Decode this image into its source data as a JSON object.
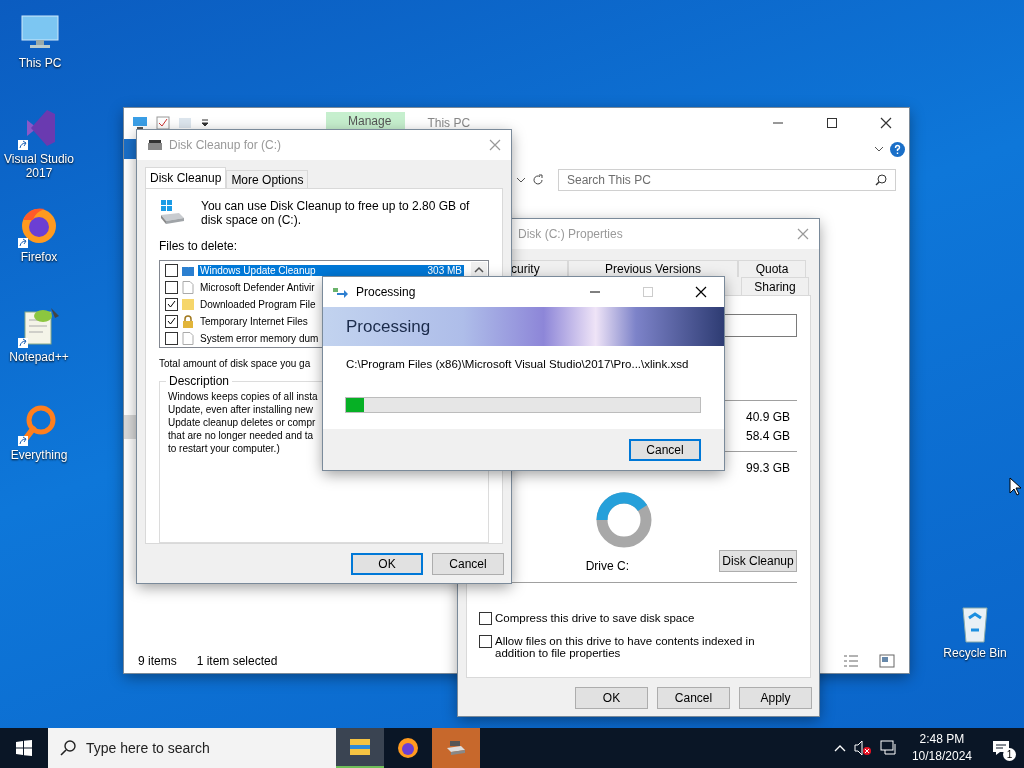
{
  "desktop_icons": [
    {
      "label": "This PC",
      "kind": "pc"
    },
    {
      "label": "Visual Studio 2017",
      "kind": "vs"
    },
    {
      "label": "Firefox",
      "kind": "firefox"
    },
    {
      "label": "Notepad++",
      "kind": "notepad"
    },
    {
      "label": "Everything",
      "kind": "everything"
    },
    {
      "label": "Recycle Bin",
      "kind": "recycle"
    }
  ],
  "explorer": {
    "ribbon_tab": "Manage",
    "title": "This PC",
    "search": {
      "placeholder": "Search This PC"
    },
    "status_bar": [
      "9 items",
      "1 item selected"
    ]
  },
  "properties": {
    "title": "Disk (C:) Properties",
    "tabs_back": [
      {
        "label": "curity"
      },
      {
        "label": "Previous Versions"
      },
      {
        "label": "Quota"
      }
    ],
    "tabs_front": [
      {
        "label": "Sharing"
      }
    ],
    "sizes": [
      "40.9 GB",
      "58.4 GB",
      "99.3 GB"
    ],
    "drive_label": "Drive C:",
    "cleanup_button": "Disk Cleanup",
    "options": [
      {
        "label": "Compress this drive to save disk space",
        "checked": false
      },
      {
        "label": "Allow files on this drive to have contents indexed in addition to file properties",
        "checked": false
      }
    ],
    "buttons": [
      "OK",
      "Cancel",
      "Apply"
    ]
  },
  "disk_cleanup": {
    "title": "Disk Cleanup for  (C:)",
    "tabs": [
      {
        "label": "Disk Cleanup",
        "selected": true
      },
      {
        "label": "More Options",
        "selected": false
      }
    ],
    "intro": "You can use Disk Cleanup to free up to 2.80 GB of disk space on  (C:).",
    "files_label": "Files to delete:",
    "files": [
      {
        "name": "Windows Update Cleanup",
        "size": "303 MB",
        "checked": false,
        "selected": true,
        "kind": "update"
      },
      {
        "name": "Microsoft Defender Antivir",
        "checked": false,
        "selected": false,
        "kind": "page"
      },
      {
        "name": "Downloaded Program File",
        "checked": true,
        "selected": false,
        "kind": "folder"
      },
      {
        "name": "Temporary Internet Files",
        "checked": true,
        "selected": false,
        "kind": "lock"
      },
      {
        "name": "System error memory dum",
        "checked": false,
        "selected": false,
        "kind": "page"
      }
    ],
    "total_label": "Total amount of disk space you ga",
    "description_title": "Description",
    "description_lines": [
      "Windows keeps copies of all insta",
      "Update, even after installing new",
      "Update cleanup deletes or compr",
      "that are no longer needed and ta",
      "to restart your computer.)"
    ],
    "buttons": [
      {
        "label": "OK",
        "default": true
      },
      {
        "label": "Cancel",
        "default": false
      }
    ]
  },
  "processing": {
    "title": "Processing",
    "heading": "Processing",
    "path": "C:\\Program Files (x86)\\Microsoft Visual Studio\\2017\\Pro...\\xlink.xsd",
    "progress": {
      "level": 0.05
    },
    "buttons": [
      "Cancel"
    ]
  },
  "taskbar": {
    "search": {
      "placeholder": "Type here to search"
    },
    "apps": [
      {
        "kind": "explorer",
        "open": true,
        "flashing": false
      },
      {
        "kind": "firefox",
        "open": false,
        "flashing": false
      },
      {
        "kind": "cleanup",
        "open": false,
        "flashing": true
      }
    ],
    "time": "2:48 PM",
    "date": "10/18/2024",
    "notification_count": "1"
  }
}
